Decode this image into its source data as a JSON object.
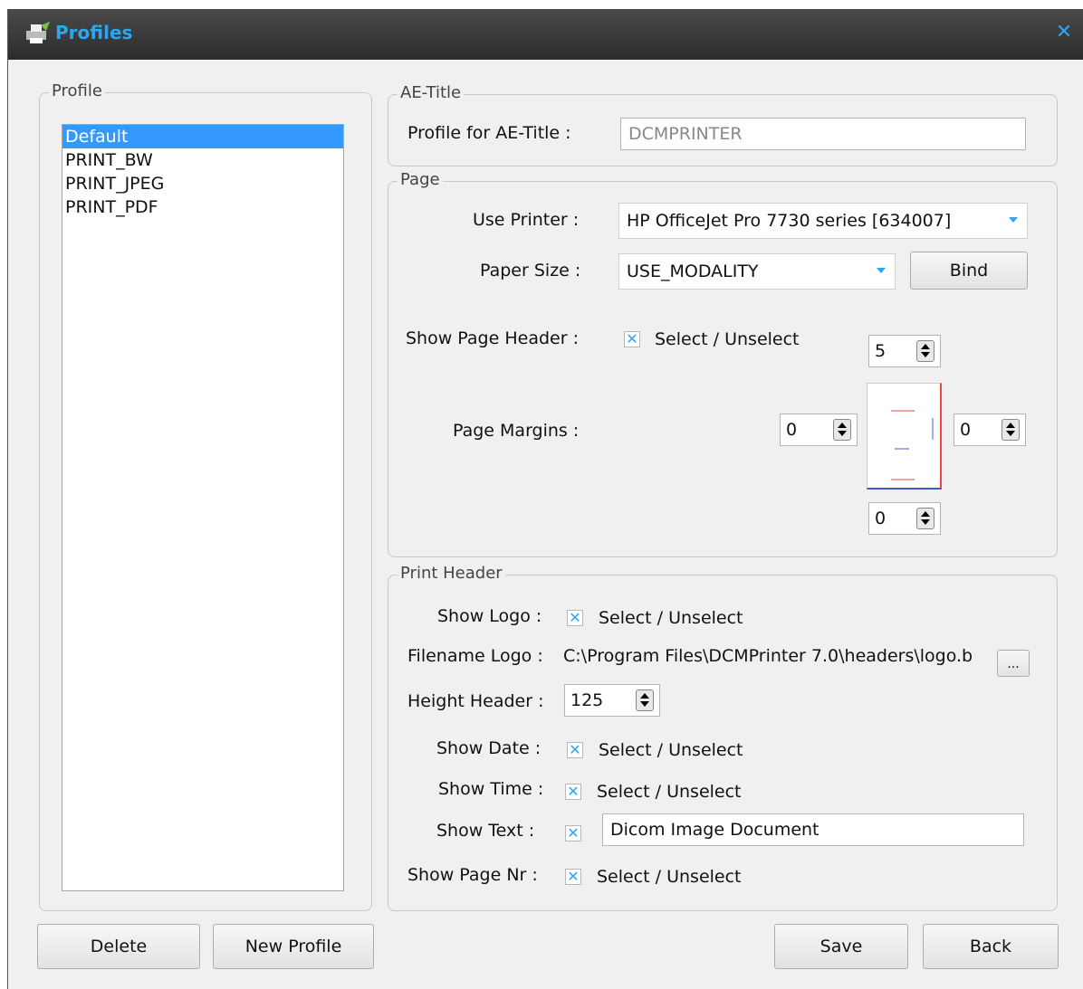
{
  "window": {
    "title": "Profiles",
    "close_glyph": "✕"
  },
  "profile_group": {
    "legend": "Profile",
    "items": [
      "Default",
      "PRINT_BW",
      "PRINT_JPEG",
      "PRINT_PDF"
    ],
    "selected_index": 0
  },
  "ae_title": {
    "legend": "AE-Title",
    "label": "Profile for AE-Title :",
    "value": "DCMPRINTER"
  },
  "page": {
    "legend": "Page",
    "printer_label": "Use Printer :",
    "printer_value": "HP OfficeJet Pro 7730 series [634007]",
    "paper_label": "Paper Size :",
    "paper_value": "USE_MODALITY",
    "bind_label": "Bind",
    "header_label": "Show Page Header :",
    "header_check_text": "Select / Unselect",
    "header_checked": true,
    "margins_label": "Page Margins :",
    "margin_top": "5",
    "margin_left": "0",
    "margin_right": "0",
    "margin_bottom": "0"
  },
  "print_header": {
    "legend": "Print Header",
    "show_logo_label": "Show Logo :",
    "show_logo_text": "Select / Unselect",
    "filename_label": "Filename Logo :",
    "filename_value": "C:\\Program Files\\DCMPrinter 7.0\\headers\\logo.b",
    "browse_label": "...",
    "height_label": "Height Header :",
    "height_value": "125",
    "show_date_label": "Show Date :",
    "show_date_text": "Select / Unselect",
    "show_time_label": "Show Time :",
    "show_time_text": "Select / Unselect",
    "show_text_label": "Show Text :",
    "show_text_value": "Dicom Image Document",
    "show_pagenr_label": "Show Page Nr :",
    "show_pagenr_text": "Select / Unselect"
  },
  "buttons": {
    "delete": "Delete",
    "new_profile": "New Profile",
    "save": "Save",
    "back": "Back"
  },
  "colors": {
    "accent": "#2aa7ef",
    "selection": "#3399ff",
    "titlebar": "#3a3a3a"
  },
  "icons": {
    "title_icon": "printer-icon",
    "check_mark": "✕"
  }
}
